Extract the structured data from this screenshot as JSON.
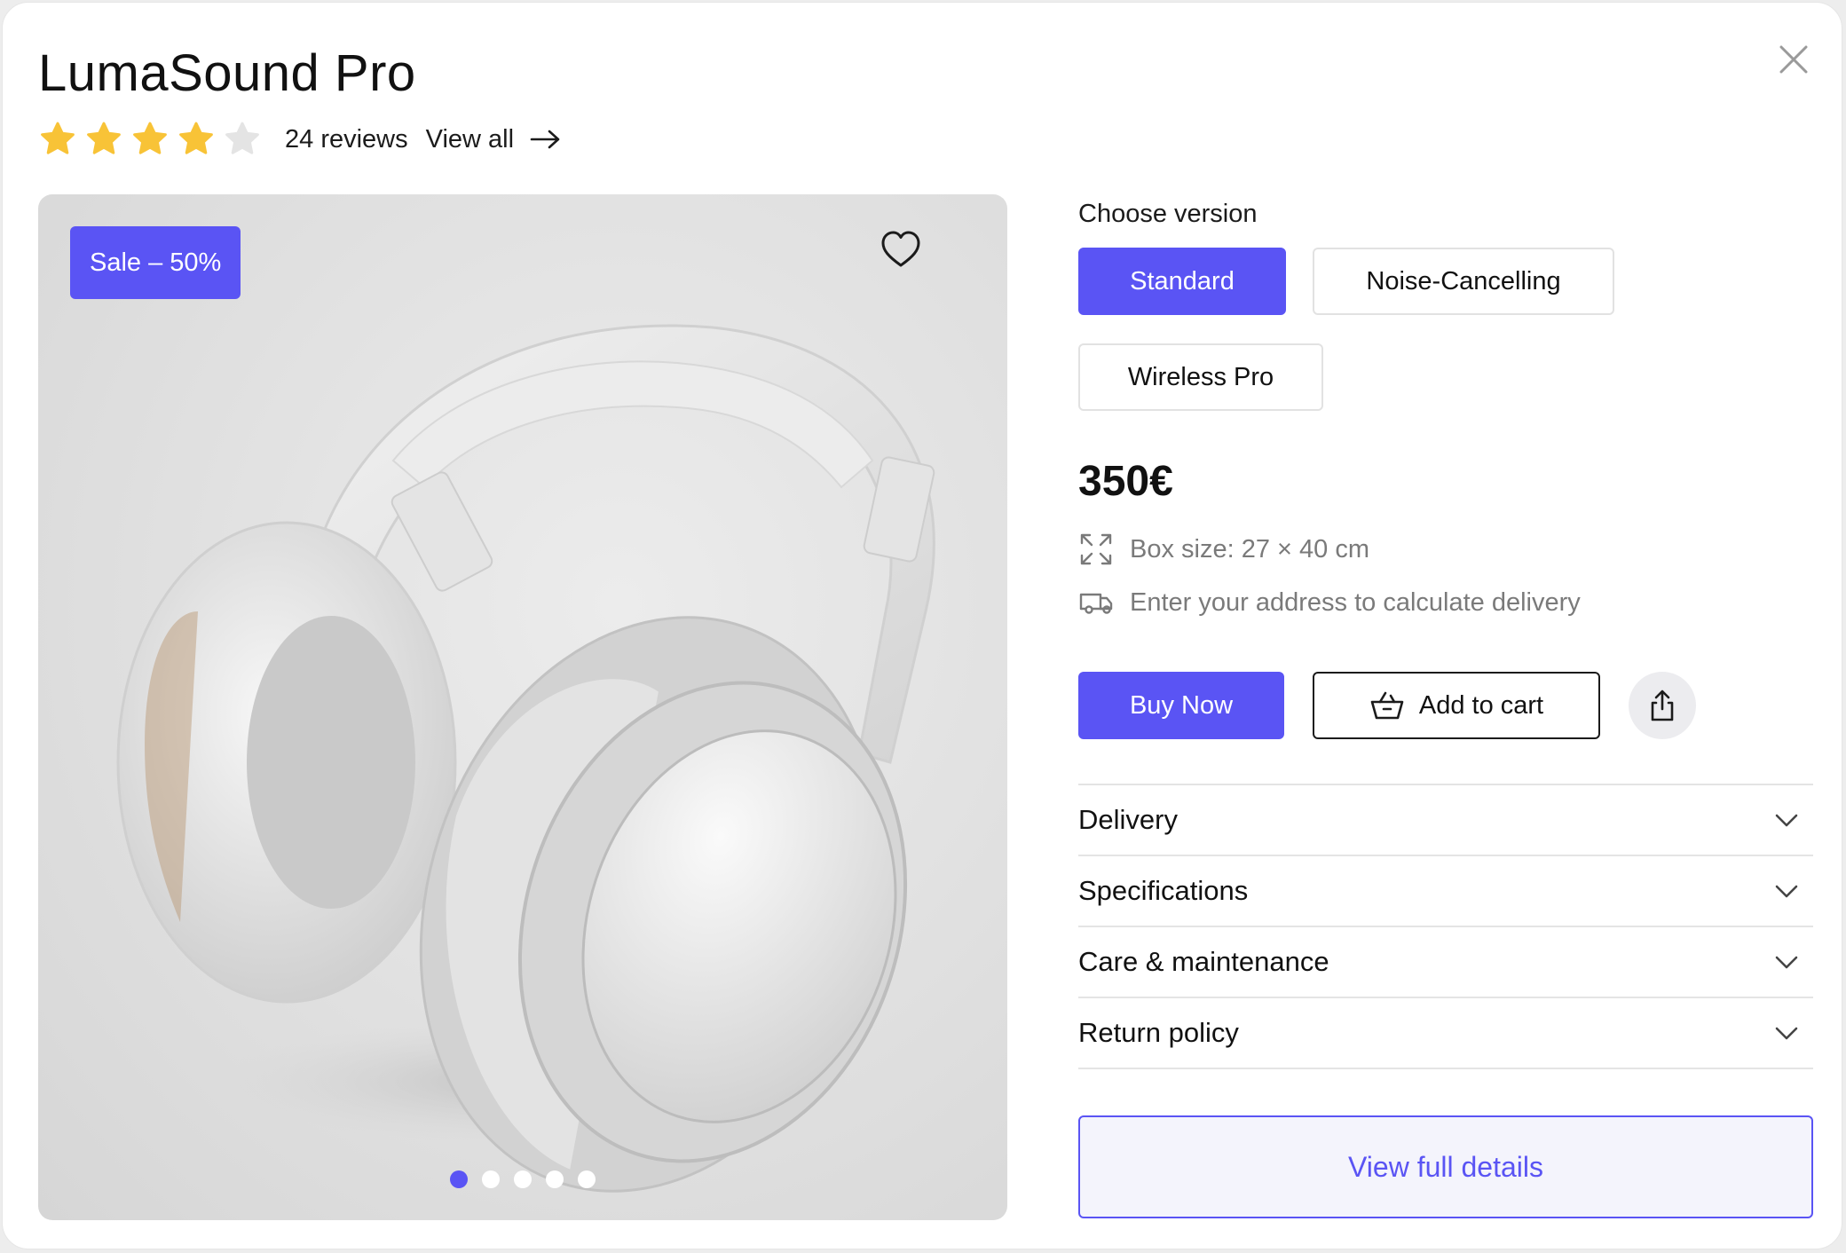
{
  "product": {
    "title": "LumaSound Pro",
    "rating": 4,
    "rating_max": 5,
    "reviews_label": "24 reviews",
    "view_all_label": "View all",
    "sale_badge": "Sale – 50%",
    "gallery": {
      "image_count": 5,
      "active_index": 0
    }
  },
  "options": {
    "label": "Choose version",
    "items": [
      {
        "label": "Standard",
        "selected": true
      },
      {
        "label": "Noise-Cancelling",
        "selected": false
      },
      {
        "label": "Wireless Pro",
        "selected": false
      }
    ]
  },
  "price": "350€",
  "meta": {
    "box_size": "Box size: 27 × 40 cm",
    "delivery": "Enter your address to calculate delivery"
  },
  "actions": {
    "buy_now": "Buy Now",
    "add_to_cart": "Add to cart"
  },
  "accordion": [
    {
      "label": "Delivery"
    },
    {
      "label": "Specifications"
    },
    {
      "label": "Care & maintenance"
    },
    {
      "label": "Return policy"
    }
  ],
  "view_details": "View full details",
  "colors": {
    "accent": "#5a54f4",
    "star_filled": "#f8c337",
    "star_empty": "#e4e4e4"
  },
  "icons": [
    "close-icon",
    "star-icon",
    "arrow-right-icon",
    "heart-icon",
    "expand-icon",
    "truck-icon",
    "basket-icon",
    "share-icon",
    "chevron-down-icon"
  ]
}
